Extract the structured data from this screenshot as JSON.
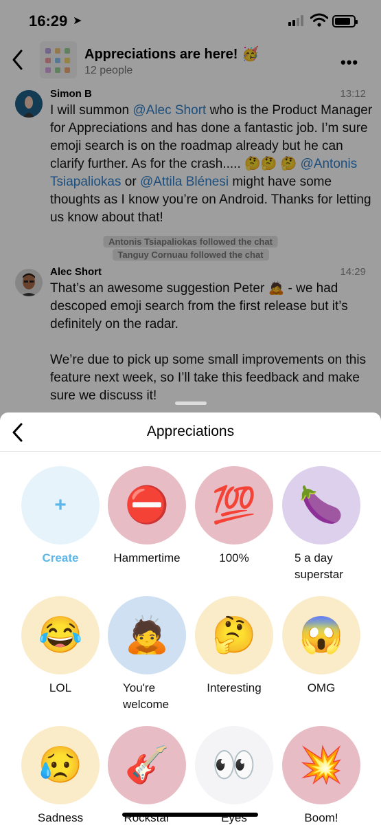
{
  "status_bar": {
    "time": "16:29",
    "location_glyph": "➤"
  },
  "chat": {
    "title": "Appreciations are here! 🥳",
    "subtitle": "12 people",
    "more_label": "•••",
    "messages": [
      {
        "author": "Simon B",
        "time": "13:12",
        "parts": [
          "I will summon ",
          "@Alec Short",
          " who is the Product Manager for Appreciations and has done a fantastic job. I’m sure emoji search is on the roadmap already but he can clarify further. As for the crash..... 🤔🤔 🤔 ",
          "@Antonis Tsiapaliokas",
          " or ",
          "@Attila Blénesi",
          " might have some thoughts as I know you’re on Android. Thanks for letting us know about that!"
        ]
      },
      {
        "author": "Alec Short",
        "time": "14:29",
        "body": "That’s an awesome suggestion Peter 🙇 - we had descoped emoji search from the first release but it’s definitely on the radar.\n\nWe’re due to pick up some small improvements on this feature next week, so I’ll take this feedback and make sure we discuss it!"
      }
    ],
    "system_events": [
      "Antonis Tsiapaliokas followed the chat",
      "Tanguy Cornuau followed the chat"
    ]
  },
  "sheet": {
    "title": "Appreciations",
    "tiles": [
      {
        "label": "Create",
        "glyph": "+",
        "bg": "#e6f3fb"
      },
      {
        "label": "Hammertime",
        "glyph": "⛔",
        "bg": "#e8bcc4"
      },
      {
        "label": "100%",
        "glyph": "💯",
        "bg": "#e8bcc4"
      },
      {
        "label": "5 a day\nsuperstar",
        "glyph": "🍆",
        "bg": "#dcd0ec"
      },
      {
        "label": "LOL",
        "glyph": "😂",
        "bg": "#fbecc9"
      },
      {
        "label": "You're\nwelcome",
        "glyph": "🙇",
        "bg": "#cfe0f2"
      },
      {
        "label": "Interesting",
        "glyph": "🤔",
        "bg": "#fbecc9"
      },
      {
        "label": "OMG",
        "glyph": "😱",
        "bg": "#fbecc9"
      },
      {
        "label": "Sadness",
        "glyph": "😥",
        "bg": "#fbecc9"
      },
      {
        "label": "Rockstar",
        "glyph": "🎸",
        "bg": "#e8bcc4"
      },
      {
        "label": "Eyes",
        "glyph": "👀",
        "bg": "#f4f4f6"
      },
      {
        "label": "Boom!",
        "glyph": "💥",
        "bg": "#e8bcc4"
      }
    ]
  },
  "colors": {
    "accent": "#5cb7e8",
    "mention": "#2f7fc8"
  }
}
